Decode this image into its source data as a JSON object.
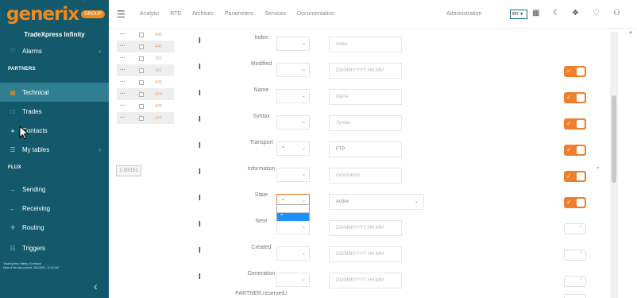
{
  "sidebar": {
    "logo": "generix",
    "logo_badge": "GROUP",
    "app_name": "TradeXpress Infinity",
    "alarms": "Alarms",
    "section_partners": "PARTNERS",
    "technical": "Technical",
    "trades": "Trades",
    "contacts": "Contacts",
    "my_tables": "My tables",
    "section_flux": "FLUX",
    "sending": "Sending",
    "receiving": "Receiving",
    "routing": "Routing",
    "triggers": "Triggers",
    "footer_line1": "TradeXpress Infinity v3 version",
    "footer_line2": "Date of the last commit: 28/1/2021, 11:00 AM"
  },
  "topbar": {
    "nav": [
      "Analytic",
      "RTE",
      "Archives",
      "Parameters",
      "Services",
      "Documentation"
    ],
    "admin": "Administration",
    "lang": "en"
  },
  "list": {
    "rows": [
      "446",
      "445",
      "162",
      "161",
      "435",
      "424",
      "425",
      "426"
    ],
    "pager": "1-50/151"
  },
  "form": {
    "rows": [
      {
        "label": "Index",
        "op": "",
        "input": "Index",
        "toggle": "none"
      },
      {
        "label": "Modified",
        "op": "",
        "input": "DD/MM/YYYY HH:MM",
        "toggle": "on"
      },
      {
        "label": "Name",
        "op": "",
        "input": "Name",
        "toggle": "on"
      },
      {
        "label": "Syntax",
        "op": "",
        "input": "Syntax",
        "toggle": "on"
      },
      {
        "label": "Transport",
        "op": "=",
        "input": "FTP",
        "toggle": "on"
      },
      {
        "label": "Information",
        "op": "",
        "input": "Information",
        "toggle": "on"
      },
      {
        "label": "State",
        "op": "=",
        "input": "Active",
        "toggle": "on"
      },
      {
        "label": "Next",
        "op": "",
        "input": "DD/MM/YYYY HH:MM",
        "toggle": "off"
      },
      {
        "label": "Created",
        "op": "",
        "input": "DD/MM/YYYY HH:MM",
        "toggle": "off"
      },
      {
        "label": "Generation",
        "op": "",
        "input": "DD/MM/YYYY HH:MM",
        "toggle": "off"
      },
      {
        "label": "PARTNER.reserved.l",
        "op": "",
        "input": "",
        "toggle": "off"
      }
    ],
    "dropdown_opt1": "",
    "dropdown_opt2": "="
  },
  "colors": {
    "sidebar": "#13596b",
    "accent": "#f07e2a",
    "brand": "#f08a1c"
  }
}
